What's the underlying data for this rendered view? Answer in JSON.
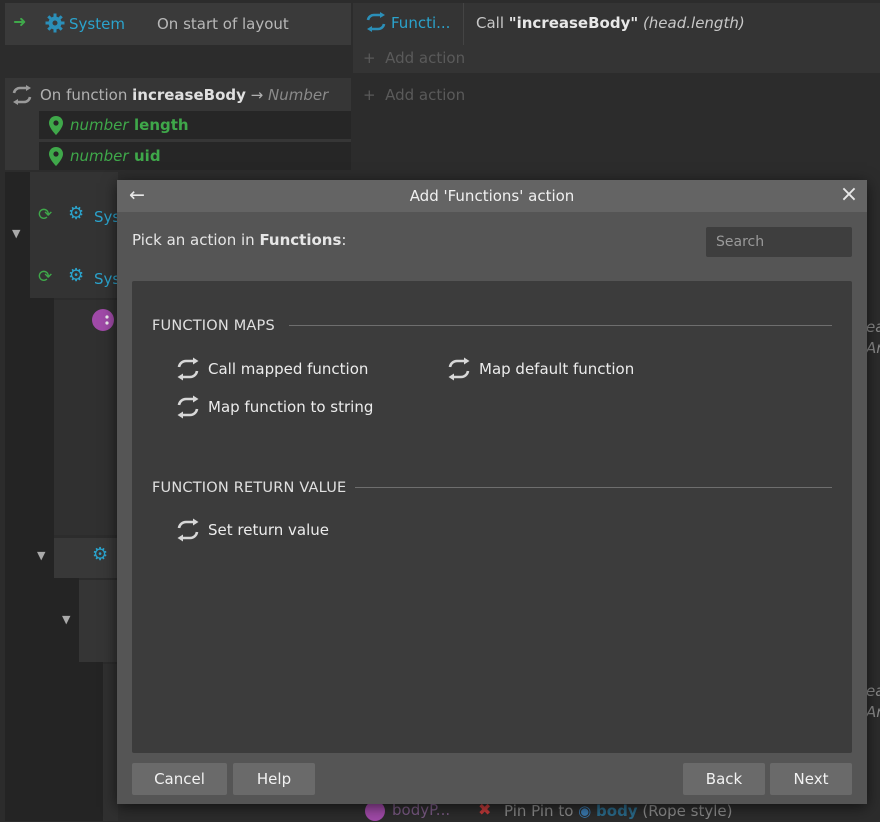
{
  "sheet": {
    "row1": {
      "condition_object": "System",
      "condition_text": "On start of layout",
      "action_object": "Functi...",
      "action_call_prefix": "Call ",
      "action_call_name": "\"increaseBody\"",
      "action_call_args": "(head.length)",
      "add_action": "Add action"
    },
    "row2": {
      "prefix": "On function ",
      "function_name": "increaseBody",
      "arrow": "→",
      "return_type": "Number",
      "params": [
        {
          "type": "number",
          "name": "length"
        },
        {
          "type": "number",
          "name": "uid"
        }
      ],
      "add_action": "Add action"
    },
    "nested": {
      "object_a": "Sys",
      "object_b": "Sys",
      "right_text_a1": "ea",
      "right_text_a2": "Ar",
      "right_text_b1": "ea",
      "right_text_b2": "Ar"
    },
    "bottom_row": {
      "object": "bodyP...",
      "action_text": "Pin Pin to ",
      "target": "body",
      "suffix": "(Rope style)"
    }
  },
  "dialog": {
    "title": "Add 'Functions' action",
    "prompt_prefix": "Pick an action in ",
    "prompt_category": "Functions",
    "prompt_suffix": ":",
    "search_placeholder": "Search",
    "sections": [
      {
        "title": "FUNCTION MAPS",
        "items": [
          "Call mapped function",
          "Map default function",
          "Map function to string"
        ]
      },
      {
        "title": "FUNCTION RETURN VALUE",
        "items": [
          "Set return value"
        ]
      }
    ],
    "buttons": {
      "cancel": "Cancel",
      "help": "Help",
      "back": "Back",
      "next": "Next"
    }
  },
  "colors": {
    "accent_cyan": "#2ba3cc",
    "param_green": "#3fa84a",
    "dialog_bg": "#555555",
    "panel_bg": "#3c3c3c"
  }
}
